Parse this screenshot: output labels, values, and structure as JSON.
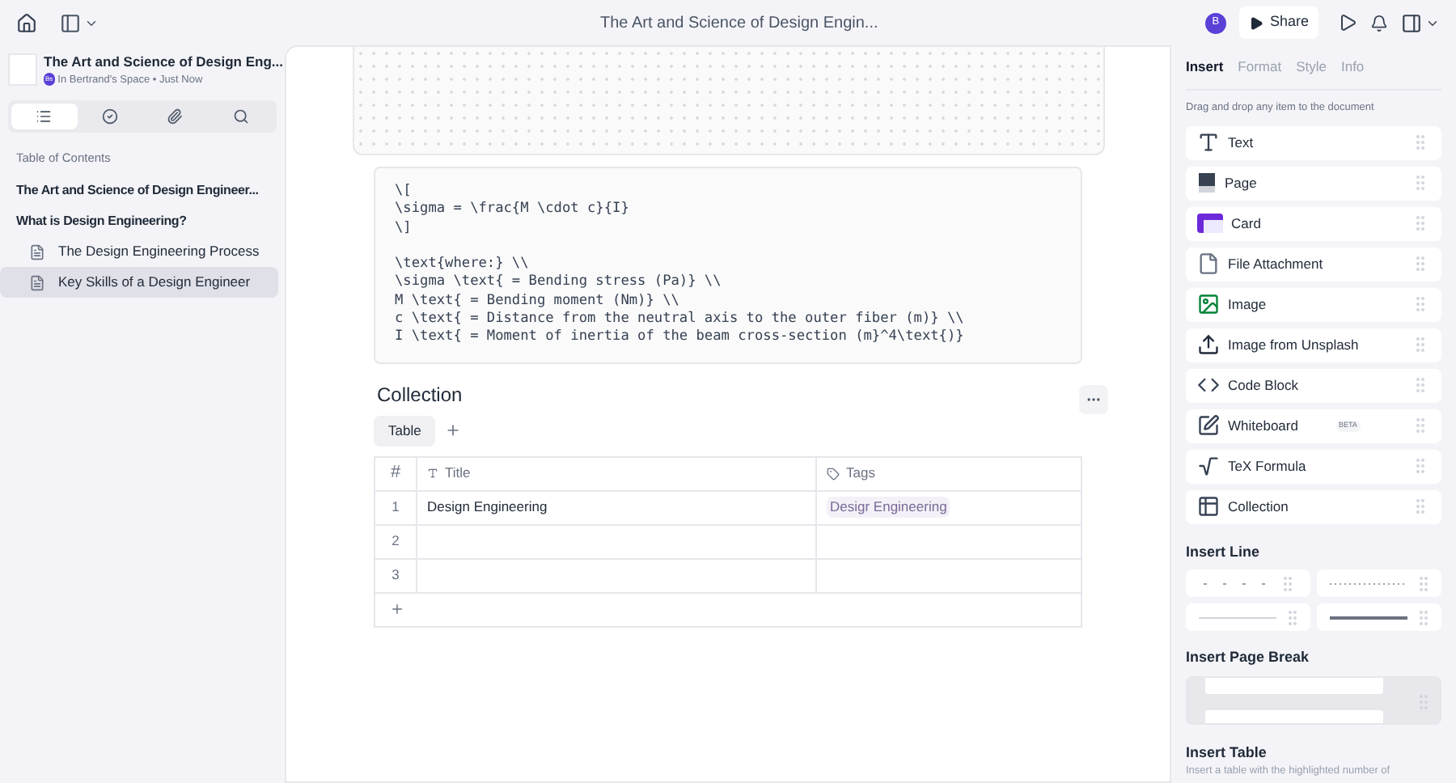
{
  "top_bar": {
    "title": "The Art and Science of Design Engin...",
    "avatar": "B",
    "share": "Share"
  },
  "document_header": {
    "title": "The Art and Science of Design Eng...",
    "space_badge": "Bs",
    "location": "In Bertrand's Space • Just Now"
  },
  "sidebar_tabs": [
    {
      "selected": true
    },
    {
      "selected": false
    },
    {
      "selected": false
    },
    {
      "selected": false
    }
  ],
  "toc": {
    "heading": "Table of Contents",
    "items": [
      {
        "label": "The Art and Science of Design Engineer...",
        "selected": false
      },
      {
        "label": "What is Design Engineering?",
        "selected": false,
        "children": [
          {
            "label": "The Design Engineering Process",
            "selected": false
          },
          {
            "label": "Key Skills of a Design Engineer",
            "selected": true
          }
        ]
      }
    ]
  },
  "code_block": "\\[\n\\sigma = \\frac{M \\cdot c}{I}\n\\]\n\n\\text{where:} \\\\\n\\sigma \\text{ = Bending stress (Pa)} \\\\\nM \\text{ = Bending moment (Nm)} \\\\\nc \\text{ = Distance from the neutral axis to the outer fiber (m)} \\\\\nI \\text{ = Moment of inertia of the beam cross-section (m}^4\\text{)}",
  "collection": {
    "title": "Collection",
    "views": [
      {
        "label": "Table",
        "selected": true
      }
    ],
    "columns": [
      "#",
      "Title",
      "Tags"
    ],
    "rows": [
      {
        "index": "1",
        "title": "Design Engineering",
        "tag": "Desigr Engineering"
      },
      {
        "index": "2"
      },
      {
        "index": "3"
      }
    ]
  },
  "right_panel": {
    "tabs": [
      {
        "label": "Insert",
        "selected": true
      },
      {
        "label": "Format",
        "selected": false
      },
      {
        "label": "Style",
        "selected": false
      },
      {
        "label": "Info",
        "selected": false
      }
    ],
    "hint": "Drag and drop any item to the document",
    "items": [
      {
        "label": "Text"
      },
      {
        "label": "Page"
      },
      {
        "label": "Card"
      },
      {
        "label": "File Attachment"
      },
      {
        "label": "Image"
      },
      {
        "label": "Image from Unsplash"
      },
      {
        "label": "Code Block"
      },
      {
        "label": "Whiteboard",
        "badge": "BETA"
      },
      {
        "label": "TeX Formula"
      },
      {
        "label": "Collection"
      }
    ],
    "insert_line": {
      "heading": "Insert Line",
      "options": [
        {
          "kind": "spaced"
        },
        {
          "kind": "dotted"
        },
        {
          "kind": "thin"
        },
        {
          "kind": "thick"
        }
      ]
    },
    "insert_page_break": {
      "heading": "Insert Page Break"
    },
    "insert_table": {
      "heading": "Insert Table",
      "description": "Insert a table with the highlighted number of"
    }
  }
}
